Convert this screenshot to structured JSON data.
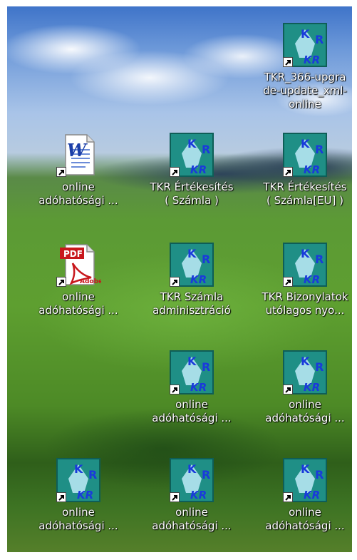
{
  "desktop": {
    "icons": [
      {
        "type": "tkr",
        "line1": "TKR_366-upgra",
        "line2": "de-update_xml-",
        "line3": "online"
      },
      {
        "type": "word",
        "line1": "online",
        "line2": "adóhatósági ..."
      },
      {
        "type": "tkr",
        "line1": "TKR Értékesítés",
        "line2": "( Számla )"
      },
      {
        "type": "tkr",
        "line1": "TKR Értékesítés",
        "line2": "( Számla[EU] )"
      },
      {
        "type": "pdf",
        "line1": "online",
        "line2": "adóhatósági ...",
        "badge_pdf": "PDF",
        "badge_adobe": "Adobe"
      },
      {
        "type": "tkr",
        "line1": "TKR Számla",
        "line2": "adminisztráció"
      },
      {
        "type": "tkr",
        "line1": "TKR Bizonylatok",
        "line2": "utólagos nyo..."
      },
      {
        "type": "tkr",
        "line1": "online",
        "line2": "adóhatósági ..."
      },
      {
        "type": "tkr",
        "line1": "online",
        "line2": "adóhatósági ..."
      },
      {
        "type": "tkr",
        "line1": "online",
        "line2": "adóhatósági ..."
      },
      {
        "type": "tkr",
        "line1": "online",
        "line2": "adóhatósági ..."
      },
      {
        "type": "tkr",
        "line1": "online",
        "line2": "adóhatósági ..."
      }
    ],
    "tkr_logo": {
      "k": "K",
      "r": "R",
      "kr": "KR"
    },
    "word_logo": "W",
    "colors": {
      "tkr_bg": "#1f8f86",
      "tkr_blue": "#1a3adb",
      "label_text": "#ffffff"
    }
  }
}
